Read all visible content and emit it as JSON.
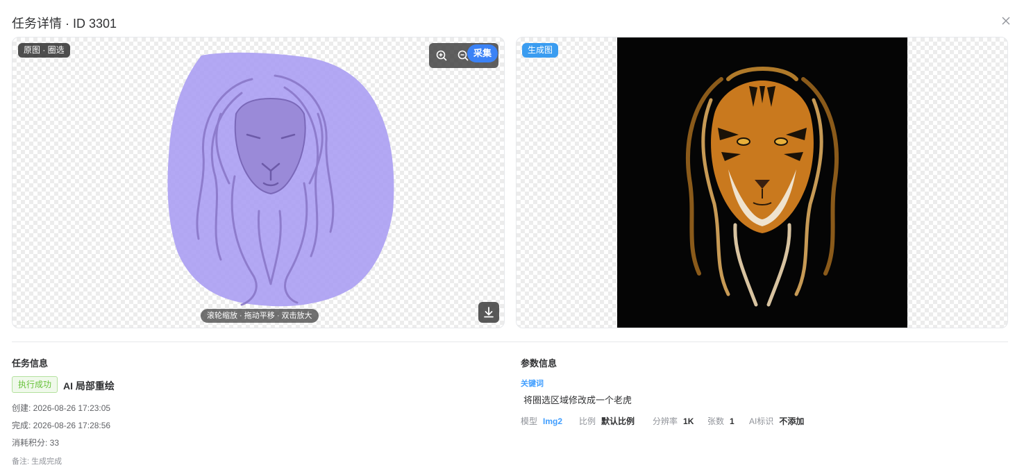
{
  "header": {
    "title": "任务详情 · ID 3301",
    "close_icon": "close-icon"
  },
  "left_panel": {
    "tag": "原图 · 圈选",
    "toolbar": {
      "zoom_in_icon": "zoom-in-icon",
      "zoom_out_icon": "zoom-out-icon",
      "collect_label": "采集"
    },
    "hint": "滚轮缩放 · 拖动平移 · 双击放大",
    "download_icon": "download-icon",
    "mask_color": "#a99cf2"
  },
  "right_panel": {
    "tag": "生成图"
  },
  "task_info": {
    "title": "任务信息",
    "status": "执行成功",
    "status_color": "#67c23a",
    "type": "AI 局部重绘",
    "created": "创建: 2026-08-26 17:23:05",
    "finished": "完成: 2026-08-26 17:28:56",
    "points": "消耗积分: 33",
    "note": "备注: 生成完成"
  },
  "param_info": {
    "title": "参数信息",
    "keyword_label": "关键词",
    "keyword_value": "将圈选区域修改成一个老虎",
    "params": [
      {
        "label": "模型",
        "value": "Img2"
      },
      {
        "label": "比例",
        "value": "默认比例"
      },
      {
        "label": "分辨率",
        "value": "1K"
      },
      {
        "label": "张数",
        "value": "1"
      },
      {
        "label": "AI标识",
        "value": "不添加"
      }
    ]
  },
  "colors": {
    "accent": "#409eff",
    "success": "#67c23a",
    "collect_button": "#3b82f6"
  }
}
